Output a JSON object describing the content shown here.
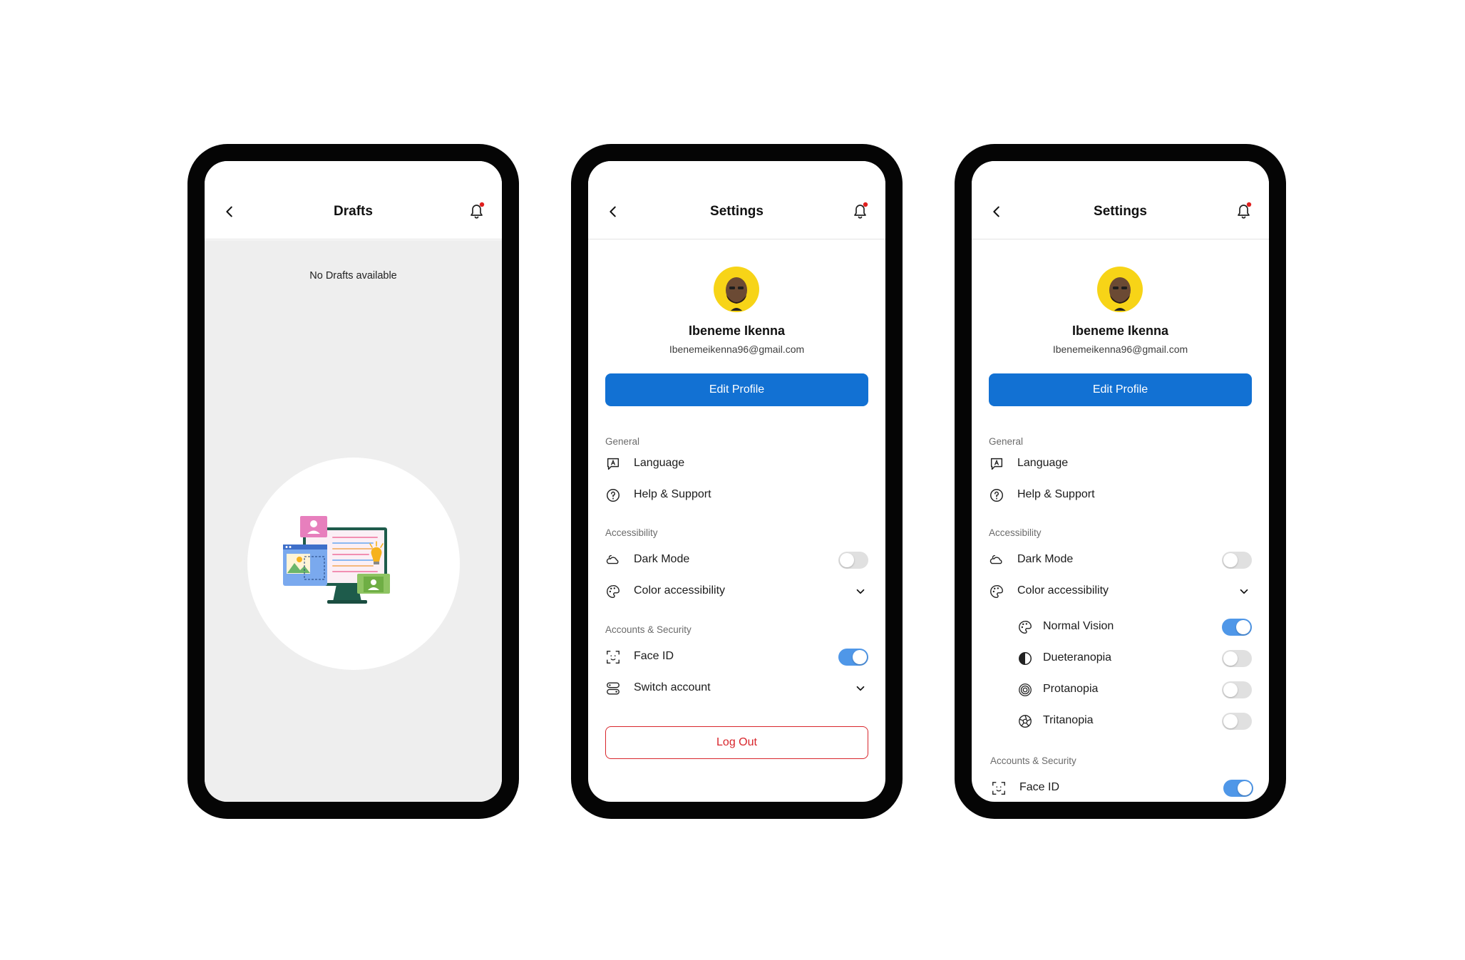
{
  "drafts_screen": {
    "title": "Drafts",
    "empty_message": "No Drafts available",
    "illustration": "drafts-illustration"
  },
  "settings_screen": {
    "title": "Settings",
    "profile": {
      "name": "Ibeneme Ikenna",
      "email": "Ibenemeikenna96@gmail.com"
    },
    "edit_profile_label": "Edit Profile",
    "general_label": "General",
    "language_label": "Language",
    "help_label": "Help & Support",
    "accessibility_label": "Accessibility",
    "dark_mode_label": "Dark Mode",
    "dark_mode_on": false,
    "color_accessibility_label": "Color accessibility",
    "accounts_label": "Accounts & Security",
    "face_id_label": "Face ID",
    "face_id_on": true,
    "switch_account_label": "Switch account",
    "logout_label": "Log Out"
  },
  "settings_expanded_screen": {
    "title": "Settings",
    "profile": {
      "name": "Ibeneme Ikenna",
      "email": "Ibenemeikenna96@gmail.com"
    },
    "edit_profile_label": "Edit Profile",
    "general_label": "General",
    "language_label": "Language",
    "help_label": "Help & Support",
    "accessibility_label": "Accessibility",
    "dark_mode_label": "Dark Mode",
    "dark_mode_on": false,
    "color_accessibility_label": "Color accessibility",
    "vision_options": [
      {
        "label": "Normal Vision",
        "on": true,
        "icon": "palette-icon"
      },
      {
        "label": "Dueteranopia",
        "on": false,
        "icon": "half-circle-icon"
      },
      {
        "label": "Protanopia",
        "on": false,
        "icon": "target-icon"
      },
      {
        "label": "Tritanopia",
        "on": false,
        "icon": "aperture-icon"
      }
    ],
    "accounts_label": "Accounts & Security",
    "face_id_label": "Face ID",
    "face_id_on": true
  },
  "colors": {
    "primary": "#1271d3",
    "toggle_on": "#4f97e8",
    "danger": "#d8262c",
    "avatar_bg": "#f7d417",
    "notification_dot": "#e0201f"
  }
}
